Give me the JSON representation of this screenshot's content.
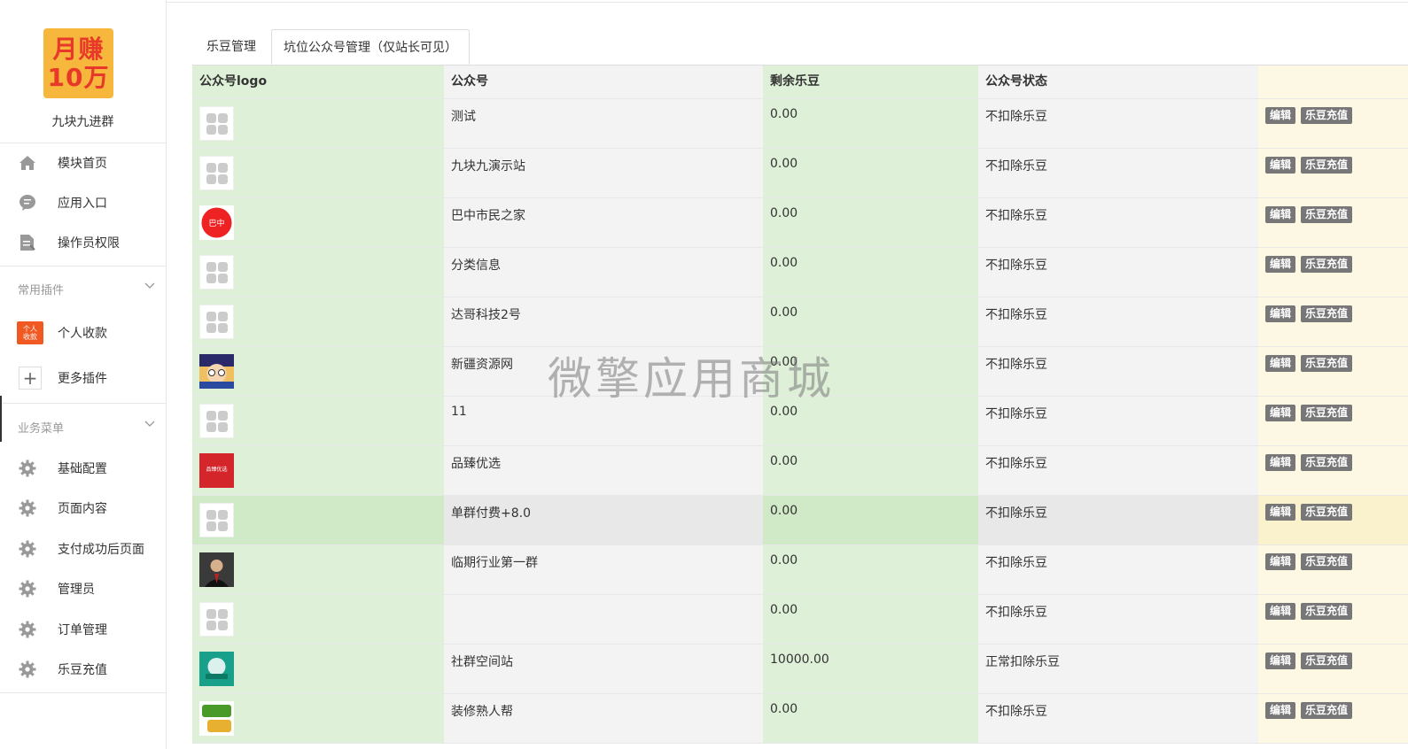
{
  "brand": {
    "logo_line1": "月赚",
    "logo_line2": "10万",
    "name": "九块九进群"
  },
  "sidebar": {
    "main_items": [
      {
        "label": "模块首页",
        "icon": "home-icon"
      },
      {
        "label": "应用入口",
        "icon": "chat-icon"
      },
      {
        "label": "操作员权限",
        "icon": "document-icon"
      }
    ],
    "plugins_title": "常用插件",
    "plugins": [
      {
        "label": "个人收款",
        "icon_text_1": "个人",
        "icon_text_2": "收款"
      },
      {
        "label": "更多插件",
        "icon": "plus-icon"
      }
    ],
    "business_title": "业务菜单",
    "business_items": [
      {
        "label": "基础配置",
        "icon": "gear-icon"
      },
      {
        "label": "页面内容",
        "icon": "gear-icon"
      },
      {
        "label": "支付成功后页面",
        "icon": "gear-icon"
      },
      {
        "label": "管理员",
        "icon": "gear-icon"
      },
      {
        "label": "订单管理",
        "icon": "gear-icon"
      },
      {
        "label": "乐豆充值",
        "icon": "gear-icon"
      }
    ]
  },
  "tabs": [
    {
      "label": "乐豆管理",
      "active": false
    },
    {
      "label": "坑位公众号管理（仅站长可见）",
      "active": true
    }
  ],
  "table": {
    "headers": [
      "公众号logo",
      "公众号",
      "剩余乐豆",
      "公众号状态",
      ""
    ],
    "edit_label": "编辑",
    "recharge_label": "乐豆充值",
    "rows": [
      {
        "logo": "placeholder",
        "name": "测试",
        "beans": "0.00",
        "status": "不扣除乐豆"
      },
      {
        "logo": "placeholder",
        "name": "九块九演示站",
        "beans": "0.00",
        "status": "不扣除乐豆"
      },
      {
        "logo": "red-circle",
        "logo_text": "巴中",
        "name": "巴中市民之家",
        "beans": "0.00",
        "status": "不扣除乐豆"
      },
      {
        "logo": "placeholder",
        "name": "分类信息",
        "beans": "0.00",
        "status": "不扣除乐豆"
      },
      {
        "logo": "placeholder",
        "name": "达哥科技2号",
        "beans": "0.00",
        "status": "不扣除乐豆"
      },
      {
        "logo": "cartoon",
        "name": "新疆资源网",
        "beans": "0.00",
        "status": "不扣除乐豆"
      },
      {
        "logo": "placeholder",
        "name": "11",
        "beans": "0.00",
        "status": "不扣除乐豆"
      },
      {
        "logo": "red-square",
        "logo_text": "品臻优选",
        "name": "品臻优选",
        "beans": "0.00",
        "status": "不扣除乐豆"
      },
      {
        "logo": "placeholder",
        "name": "单群付费+8.0",
        "beans": "0.00",
        "status": "不扣除乐豆",
        "highlight": true
      },
      {
        "logo": "portrait",
        "name": "临期行业第一群",
        "beans": "0.00",
        "status": "不扣除乐豆"
      },
      {
        "logo": "placeholder",
        "name": "",
        "beans": "0.00",
        "status": "不扣除乐豆"
      },
      {
        "logo": "teal",
        "name": "社群空间站",
        "beans": "10000.00",
        "status": "正常扣除乐豆"
      },
      {
        "logo": "green-text",
        "name": "装修熟人帮",
        "beans": "0.00",
        "status": "不扣除乐豆"
      }
    ]
  },
  "watermark": "微擎应用商城"
}
